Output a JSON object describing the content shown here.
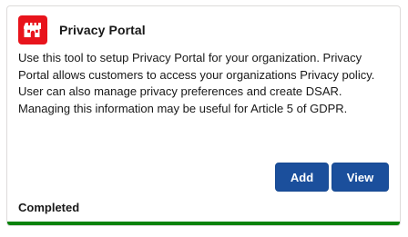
{
  "card": {
    "title": "Privacy Portal",
    "icon": "castle-tower-icon",
    "icon_color": "#e8141c",
    "description": "Use this tool to setup Privacy Portal for your organization. Privacy Portal allows customers to access your organizations Privacy policy. User can also manage privacy preferences and create DSAR. Managing this information may be useful for Article 5 of GDPR.",
    "buttons": {
      "add_label": "Add",
      "view_label": "View"
    },
    "button_color": "#1b4f9c",
    "status": "Completed",
    "progress": 1.0,
    "progress_color": "#07820b"
  }
}
